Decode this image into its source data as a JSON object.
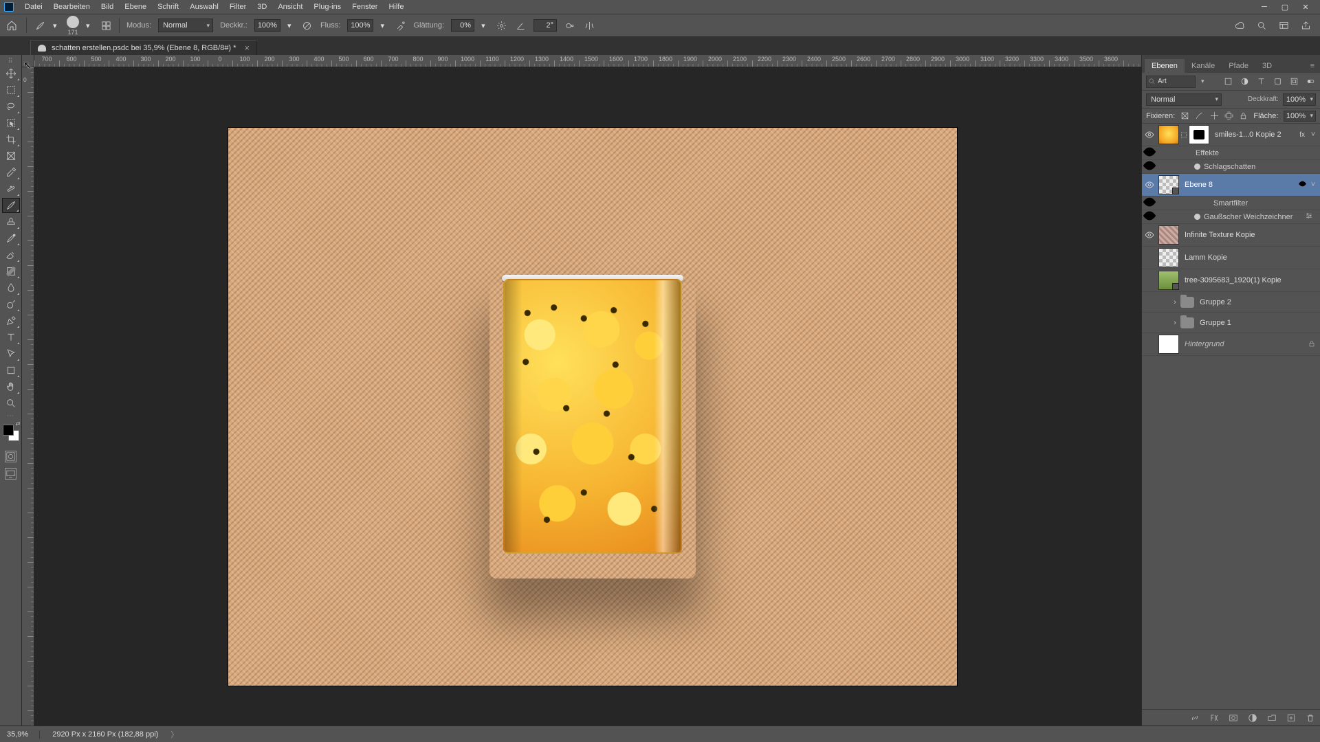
{
  "menu": {
    "items": [
      "Datei",
      "Bearbeiten",
      "Bild",
      "Ebene",
      "Schrift",
      "Auswahl",
      "Filter",
      "3D",
      "Ansicht",
      "Plug-ins",
      "Fenster",
      "Hilfe"
    ]
  },
  "options": {
    "brush_size": "171",
    "mode_label": "Modus:",
    "mode_value": "Normal",
    "opacity_label": "Deckkr.:",
    "opacity_value": "100%",
    "flow_label": "Fluss:",
    "flow_value": "100%",
    "smooth_label": "Glättung:",
    "smooth_value": "0%",
    "angle_value": "2°"
  },
  "document": {
    "title": "schatten erstellen.psdc bei 35,9% (Ebene 8, RGB/8#) *",
    "zoom": "35,9%",
    "dims": "2920 Px x 2160 Px (182,88 ppi)"
  },
  "ruler": {
    "h": [
      "700",
      "600",
      "500",
      "400",
      "300",
      "200",
      "100",
      "0",
      "100",
      "200",
      "300",
      "400",
      "500",
      "600",
      "700",
      "800",
      "900",
      "1000",
      "1100",
      "1200",
      "1300",
      "1400",
      "1500",
      "1600",
      "1700",
      "1800",
      "1900",
      "2000",
      "2100",
      "2200",
      "2300",
      "2400",
      "2500",
      "2600",
      "2700",
      "2800",
      "2900",
      "3000",
      "3100",
      "3200",
      "3300",
      "3400",
      "3500",
      "3600"
    ],
    "v": [
      "0",
      "1\n0\n0",
      "1\n5\n0",
      "2\n0\n0",
      "3\n0\n0",
      "3\n5\n0",
      "4\n0\n0",
      "5\n0\n0",
      "5\n5\n0",
      "6\n0\n0",
      "7\n0\n0",
      "8\n0\n0",
      "8\n5\n0",
      "9\n0\n0",
      "0\n0\n0",
      "0\n5\n0"
    ]
  },
  "panel": {
    "tabs": [
      "Ebenen",
      "Kanäle",
      "Pfade",
      "3D"
    ],
    "search_label": "Art",
    "blend_value": "Normal",
    "opacity_label": "Deckkraft:",
    "opacity_value": "100%",
    "lock_label": "Fixieren:",
    "fill_label": "Fläche:",
    "fill_value": "100%"
  },
  "layers": [
    {
      "vis": true,
      "thumbs": [
        "emoji",
        "mask"
      ],
      "link": "⬚",
      "name": "smiles-1...0 Kopie 2",
      "badge": "fx",
      "chev": "˅"
    },
    {
      "sub": true,
      "visdot": true,
      "text": "Effekte"
    },
    {
      "sub": true,
      "visdot": true,
      "bullet": true,
      "text": "Schlagschatten"
    },
    {
      "vis": true,
      "selected": true,
      "thumbs": [
        "checker smartcorner"
      ],
      "name": "Ebene 8",
      "filtericon": true,
      "chev": "˅"
    },
    {
      "sub": true,
      "visdot": true,
      "thumb": "white small",
      "text": "Smartfilter"
    },
    {
      "sub": true,
      "visdot": true,
      "bullet": true,
      "text": "Gaußscher Weichzeichner",
      "sliders": true
    },
    {
      "vis": true,
      "thumbs": [
        "tex"
      ],
      "name": "Infinite Texture Kopie"
    },
    {
      "vis": false,
      "thumbs": [
        "checker"
      ],
      "name": "Lamm Kopie"
    },
    {
      "vis": false,
      "thumbs": [
        "tree smartcorner"
      ],
      "name": "tree-3095683_1920(1) Kopie"
    },
    {
      "vis": false,
      "group": true,
      "chevr": "›",
      "name": "Gruppe 2"
    },
    {
      "vis": false,
      "group": true,
      "chevr": "›",
      "name": "Gruppe 1"
    },
    {
      "vis": false,
      "thumbs": [
        "white"
      ],
      "name": "Hintergrund",
      "italic": true,
      "lock": true
    }
  ]
}
